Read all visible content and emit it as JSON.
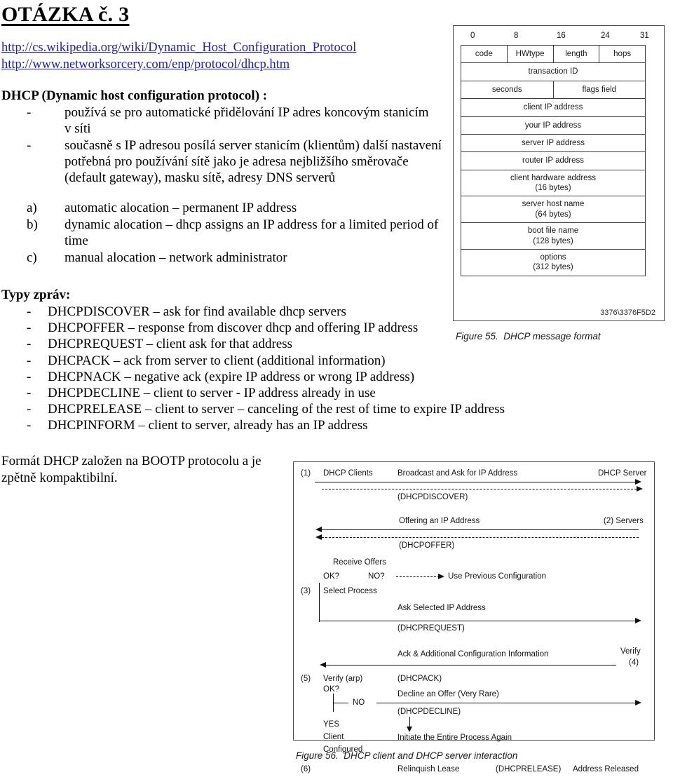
{
  "document": {
    "title": "OTÁZKA č. 3",
    "links": [
      "http://cs.wikipedia.org/wiki/Dynamic_Host_Configuration_Protocol",
      "http://www.networksorcery.com/enp/protocol/dhcp.htm"
    ],
    "dhcp_heading": "DHCP (Dynamic host configuration protocol) :",
    "dash_bullet": "-",
    "dhcp_points": [
      "používá se pro automatické přidělování IP adres koncovým stanicím\nv síti",
      "současně s IP adresou posílá server stanicím (klientům) další nastavení\npotřebná pro používání sítě jako je adresa nejbližšího směrovače\n(default gateway), masku sítě, adresy DNS serverů"
    ],
    "allocation_items": [
      {
        "marker": "a)",
        "text": "automatic alocation – permanent IP address"
      },
      {
        "marker": "b)",
        "text": "dynamic alocation – dhcp assigns an IP address for a limited period of\ntime"
      },
      {
        "marker": "c)",
        "text": "manual alocation – network administrator"
      }
    ],
    "messages_heading": "Typy zpráv:",
    "messages": [
      "DHCPDISCOVER – ask for find available dhcp servers",
      "DHCPOFFER – response from discover dhcp and offering IP address",
      "DHCPREQUEST – client ask for that address",
      "DHCPACK – ack from server to client (additional information)",
      "DHCPNACK – negative ack (expire IP address or wrong IP address)",
      "DHCPDECLINE – client to server - IP address already in use",
      "DHCPRELEASE – client to server – canceling of the rest of time to expire IP address",
      "DHCPINFORM – client to server, already has an IP address"
    ],
    "closing_note": "Formát DHCP založen na BOOTP protocolu a je\nzpětně kompaktibilní."
  },
  "figure55": {
    "caption": "Figure 55.  DHCP message format",
    "image_id": "3376\\3376F5D2",
    "bit_ruler": [
      "0",
      "8",
      "16",
      "24",
      "31"
    ],
    "rows": [
      {
        "cells": [
          {
            "label": "code"
          },
          {
            "label": "HWtype"
          },
          {
            "label": "length"
          },
          {
            "label": "hops"
          }
        ]
      },
      {
        "cells": [
          {
            "label": "transaction ID"
          }
        ]
      },
      {
        "cells": [
          {
            "label": "seconds"
          },
          {
            "label": "flags field"
          }
        ]
      },
      {
        "cells": [
          {
            "label": "client IP address"
          }
        ]
      },
      {
        "cells": [
          {
            "label": "your IP address"
          }
        ]
      },
      {
        "cells": [
          {
            "label": "server IP address"
          }
        ]
      },
      {
        "cells": [
          {
            "label": "router IP address"
          }
        ]
      },
      {
        "cells": [
          {
            "label": "client hardware address",
            "size": "(16 bytes)"
          }
        ]
      },
      {
        "cells": [
          {
            "label": "server host name",
            "size": "(64 bytes)"
          }
        ]
      },
      {
        "cells": [
          {
            "label": "boot file name",
            "size": "(128 bytes)"
          }
        ]
      },
      {
        "cells": [
          {
            "label": "options",
            "size": "(312 bytes)"
          }
        ]
      }
    ]
  },
  "figure56": {
    "caption": "Figure 56.  DHCP client and DHCP server interaction",
    "labels": {
      "step1": "(1)",
      "dhcp_clients": "DHCP Clients",
      "broadcast_ask": "Broadcast and Ask for IP Address",
      "dhcp_server": "DHCP Server",
      "dhcpdiscover": "(DHCPDISCOVER)",
      "offering_ip": "Offering an IP Address",
      "step2_servers": "(2) Servers",
      "dhcpoffer": "(DHCPOFFER)",
      "receive_offers": "Receive Offers",
      "ok_q": "OK?",
      "no_q": "NO?",
      "use_previous": "Use Previous Configuration",
      "step3": "(3)",
      "select_process": "Select Process",
      "ask_selected": "Ask Selected IP Address",
      "dhcprequest": "(DHCPREQUEST)",
      "ack_additional": "Ack & Additional Configuration Information",
      "verify": "Verify",
      "step4": "(4)",
      "step5": "(5)",
      "verify_arp": "Verify (arp)",
      "ok_q2": "OK?",
      "dhcpack": "(DHCPACK)",
      "no_branch": "NO",
      "decline_offer": "Decline an Offer (Very Rare)",
      "dhcpdecline": "(DHCPDECLINE)",
      "initiate_again": "Initiate the Entire Process Again",
      "yes_branch": "YES",
      "client": "Client",
      "configured": "Configured",
      "step6": "(6)",
      "relinquish_lease": "Relinquish Lease",
      "dhcprelease": "(DHCPRELEASE)",
      "address_released": "Address Released"
    }
  }
}
